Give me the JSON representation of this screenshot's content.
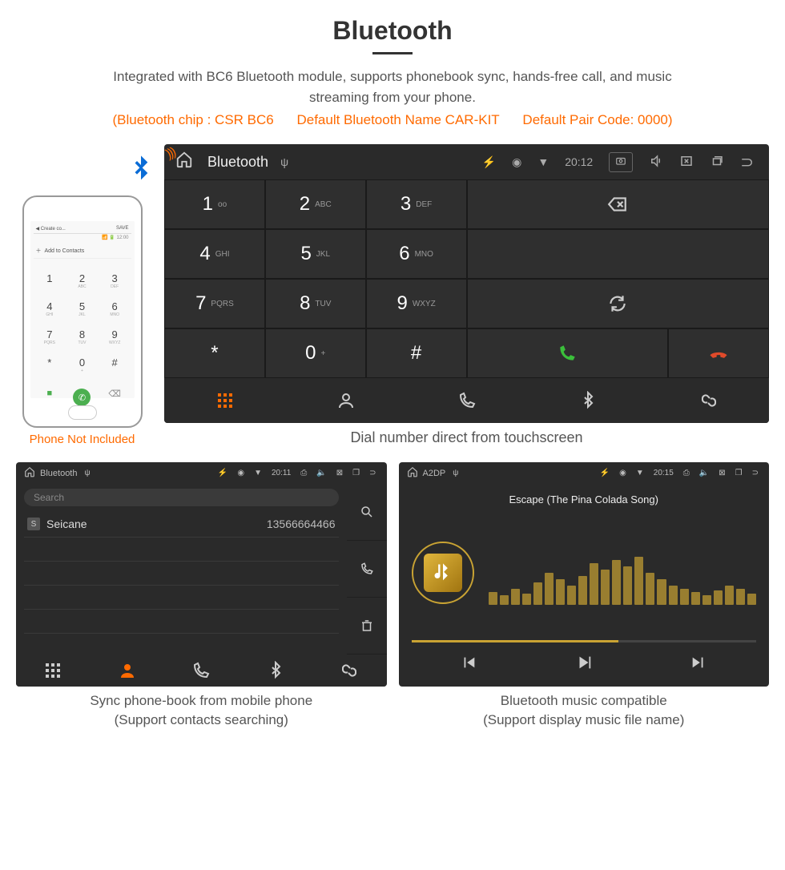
{
  "header": {
    "title": "Bluetooth",
    "subtitle": "Integrated with BC6 Bluetooth module, supports phonebook sync, hands-free call, and music streaming from your phone.",
    "spec_chip": "(Bluetooth chip : CSR BC6",
    "spec_name": "Default Bluetooth Name CAR-KIT",
    "spec_pair": "Default Pair Code: 0000)"
  },
  "phone_mock": {
    "add_contacts": "Add to Contacts",
    "header_left": "◀ Create co...",
    "header_right": "SAVE",
    "caption": "Phone Not Included",
    "keys": [
      {
        "d": "1",
        "l": ""
      },
      {
        "d": "2",
        "l": "ABC"
      },
      {
        "d": "3",
        "l": "DEF"
      },
      {
        "d": "4",
        "l": "GHI"
      },
      {
        "d": "5",
        "l": "JKL"
      },
      {
        "d": "6",
        "l": "MNO"
      },
      {
        "d": "7",
        "l": "PQRS"
      },
      {
        "d": "8",
        "l": "TUV"
      },
      {
        "d": "9",
        "l": "WXYZ"
      },
      {
        "d": "*",
        "l": ""
      },
      {
        "d": "0",
        "l": "+"
      },
      {
        "d": "#",
        "l": ""
      }
    ]
  },
  "main_device": {
    "status": {
      "app": "Bluetooth",
      "time": "20:12"
    },
    "keypad": [
      {
        "d": "1",
        "l": "oo"
      },
      {
        "d": "2",
        "l": "ABC"
      },
      {
        "d": "3",
        "l": "DEF"
      },
      {
        "d": "4",
        "l": "GHI"
      },
      {
        "d": "5",
        "l": "JKL"
      },
      {
        "d": "6",
        "l": "MNO"
      },
      {
        "d": "7",
        "l": "PQRS"
      },
      {
        "d": "8",
        "l": "TUV"
      },
      {
        "d": "9",
        "l": "WXYZ"
      },
      {
        "d": "*",
        "l": ""
      },
      {
        "d": "0",
        "l": "+"
      },
      {
        "d": "#",
        "l": ""
      }
    ],
    "caption": "Dial number direct from touchscreen"
  },
  "contacts_device": {
    "status": {
      "app": "Bluetooth",
      "time": "20:11"
    },
    "search_placeholder": "Search",
    "contact": {
      "badge": "S",
      "name": "Seicane",
      "number": "13566664466"
    },
    "caption_line1": "Sync phone-book from mobile phone",
    "caption_line2": "(Support contacts searching)"
  },
  "music_device": {
    "status": {
      "app": "A2DP",
      "time": "20:15"
    },
    "track_title": "Escape (The Pina Colada Song)",
    "caption_line1": "Bluetooth music compatible",
    "caption_line2": "(Support display music file name)",
    "viz_heights": [
      20,
      15,
      25,
      18,
      35,
      50,
      40,
      30,
      45,
      65,
      55,
      70,
      60,
      75,
      50,
      40,
      30,
      25,
      20,
      15,
      22,
      30,
      25,
      18
    ]
  }
}
